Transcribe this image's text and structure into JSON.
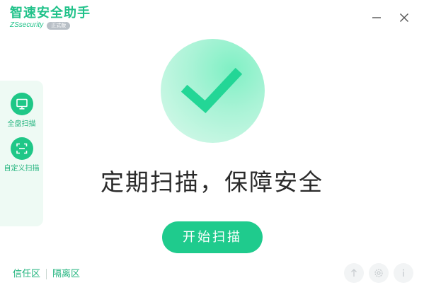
{
  "app": {
    "title": "智速安全助手",
    "subtitle": "ZSsecurity",
    "badge": "正式版"
  },
  "sidebar": {
    "items": [
      {
        "label": "全盘扫描",
        "icon": "monitor-icon"
      },
      {
        "label": "自定义扫描",
        "icon": "scan-frame-icon"
      }
    ]
  },
  "main": {
    "headline": "定期扫描，保障安全",
    "scan_button": "开始扫描"
  },
  "footer": {
    "trust_zone": "信任区",
    "quarantine_zone": "隔离区"
  },
  "colors": {
    "brand": "#21c28a",
    "button": "#1fcb8d",
    "sidebar_bg": "#eefaf4",
    "check_mark": "#23d696"
  }
}
